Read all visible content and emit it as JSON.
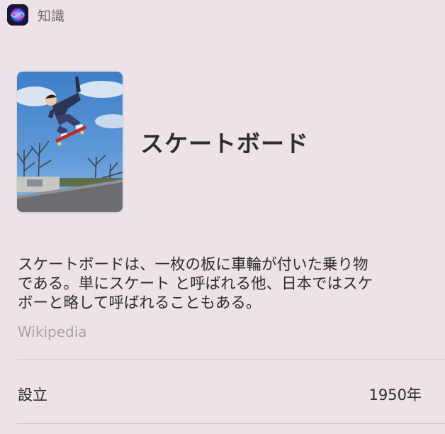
{
  "header": {
    "title": "知識",
    "icon": "siri-icon"
  },
  "entity": {
    "title": "スケートボード",
    "image": "skateboarder-photo",
    "description_lines": [
      "スケートボードは、一枚の板に車輪が付いた乗り物",
      "である。単にスケート と呼ばれる他、日本ではスケ",
      "ボーと略して呼ばれることもある。"
    ],
    "source": "Wikipedia"
  },
  "facts": [
    {
      "label": "設立",
      "value": "1950年"
    }
  ]
}
